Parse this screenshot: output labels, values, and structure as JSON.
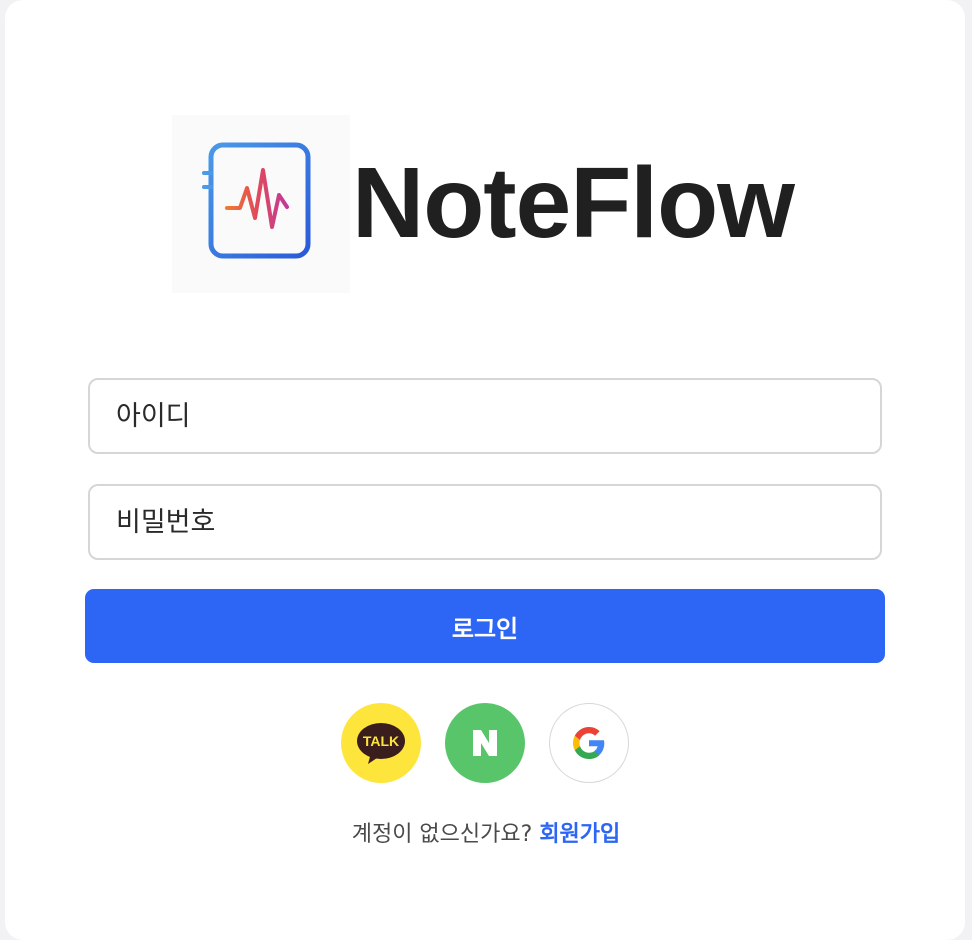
{
  "brand": {
    "name": "NoteFlow",
    "icon": "notebook-waveform-icon"
  },
  "form": {
    "id_placeholder": "아이디",
    "id_value": "",
    "password_placeholder": "비밀번호",
    "password_value": "",
    "login_label": "로그인"
  },
  "social": {
    "kakao_icon": "kakao-talk-icon",
    "kakao_label": "TALK",
    "naver_icon": "naver-icon",
    "naver_label": "N",
    "google_icon": "google-icon"
  },
  "signup": {
    "prompt": "계정이 없으신가요?",
    "link_label": "회원가입"
  },
  "colors": {
    "accent": "#2d66f5",
    "kakao": "#fee53b",
    "naver": "#59c56a",
    "text": "#202020"
  }
}
